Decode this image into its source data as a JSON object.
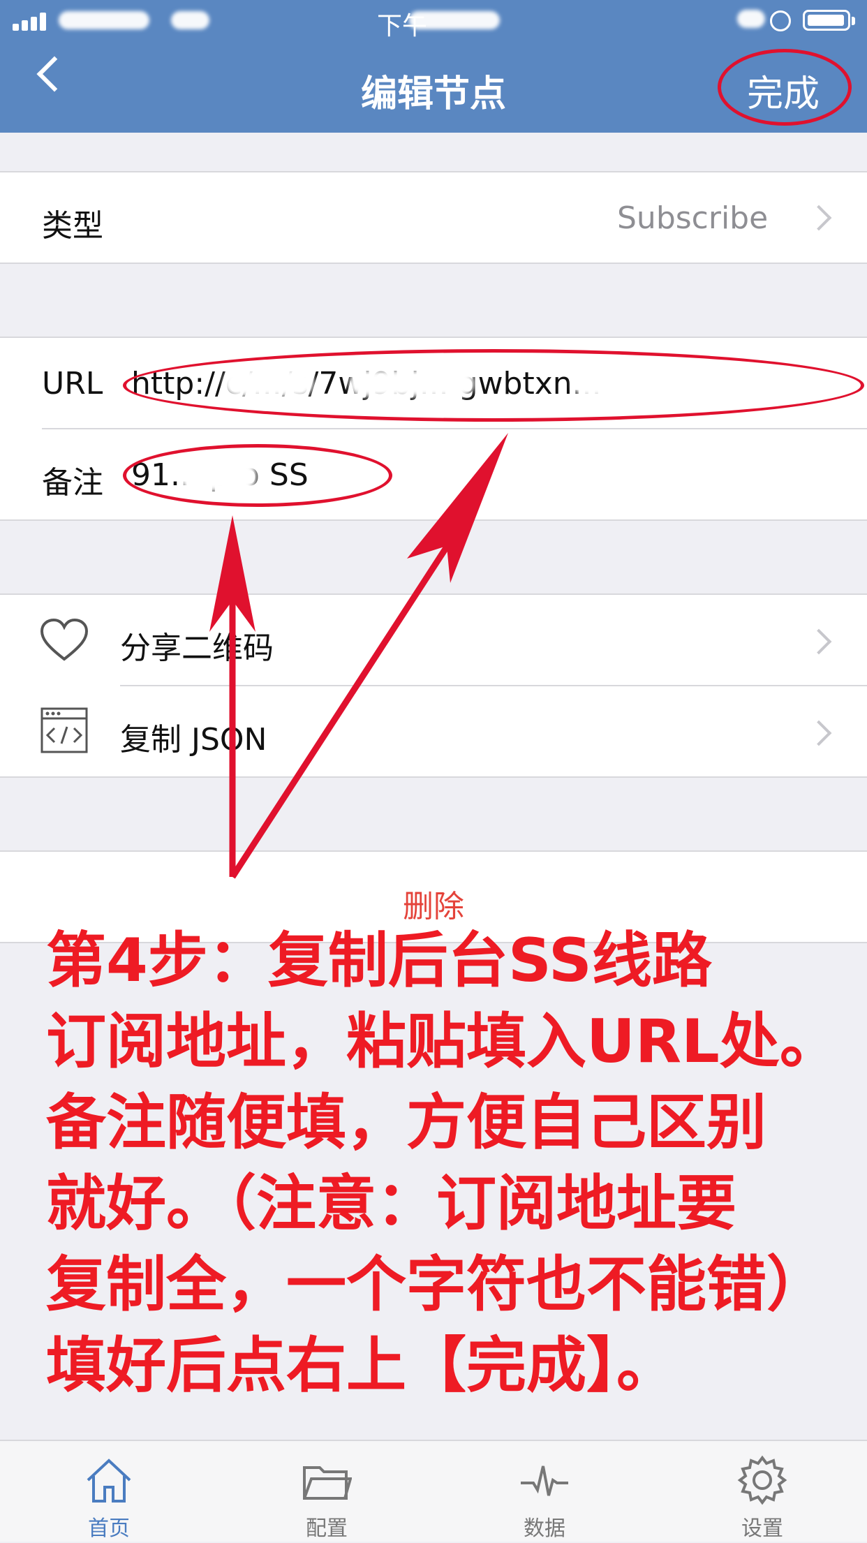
{
  "status_bar": {
    "time": "下午"
  },
  "nav": {
    "title": "编辑节点",
    "done": "完成"
  },
  "type_row": {
    "label": "类型",
    "value": "Subscribe"
  },
  "url_row": {
    "label": "URL",
    "value": "http://c/.../s/7wj9bj... gwbtxn..."
  },
  "note_row": {
    "label": "备注",
    "value": "91... pro SS"
  },
  "actions": {
    "share_qr": "分享二维码",
    "copy_json": "复制 JSON"
  },
  "delete_label": "删除",
  "annotation": {
    "lines": [
      "第4步：复制后台SS线路",
      "订阅地址，粘贴填入URL处。",
      "备注随便填，方便自己区别",
      "就好。（注意：订阅地址要",
      "复制全，一个字符也不能错）",
      "填好后点右上【完成】。"
    ]
  },
  "tabs": [
    {
      "label": "首页",
      "icon": "home-icon",
      "active": true
    },
    {
      "label": "配置",
      "icon": "folder-icon",
      "active": false
    },
    {
      "label": "数据",
      "icon": "pulse-icon",
      "active": false
    },
    {
      "label": "设置",
      "icon": "gear-icon",
      "active": false
    }
  ],
  "colors": {
    "nav_bg": "#5a87c1",
    "annotation_red": "#ee1b24",
    "delete_red": "#e4433a",
    "tab_active": "#4a7cc0"
  }
}
